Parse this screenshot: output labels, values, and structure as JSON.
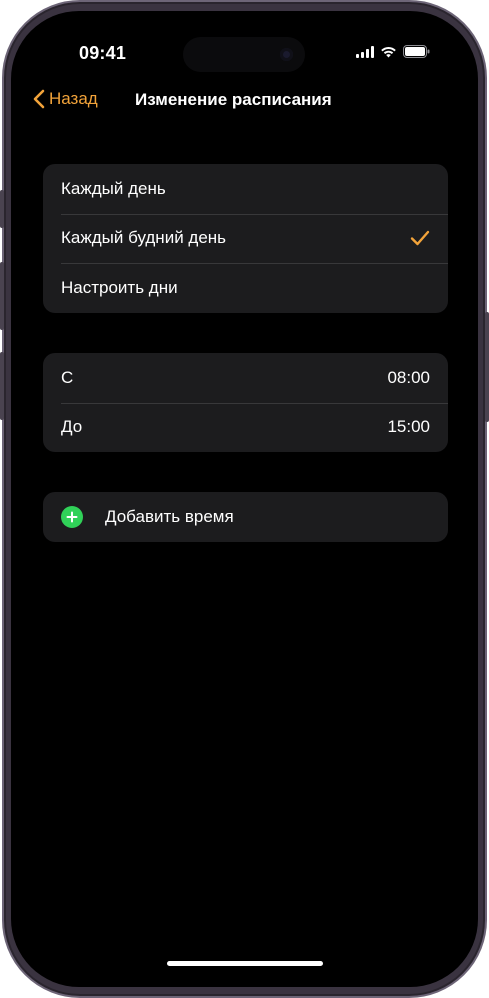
{
  "status_bar": {
    "time": "09:41",
    "icons": [
      "signal-icon",
      "wifi-icon",
      "battery-icon"
    ]
  },
  "nav": {
    "back_label": "Назад",
    "title": "Изменение расписания",
    "accent_color": "#f2a33a"
  },
  "repeat_options": [
    {
      "label": "Каждый день",
      "selected": false
    },
    {
      "label": "Каждый будний день",
      "selected": true
    },
    {
      "label": "Настроить дни",
      "selected": false
    }
  ],
  "time_range": {
    "from_label": "С",
    "from_value": "08:00",
    "to_label": "До",
    "to_value": "15:00"
  },
  "add_time": {
    "label": "Добавить время",
    "icon": "plus-circle-icon",
    "icon_color": "#30d158"
  }
}
